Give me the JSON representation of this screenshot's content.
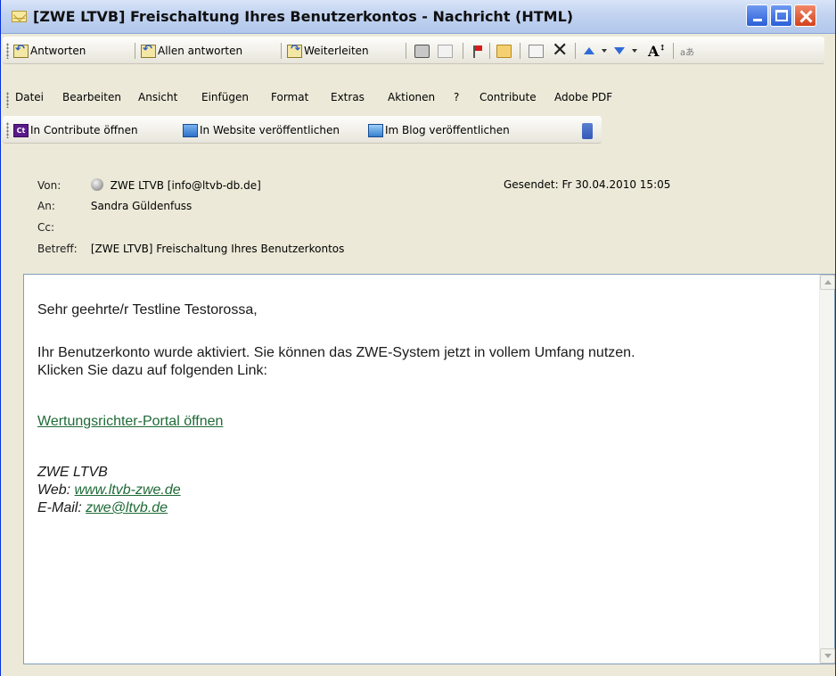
{
  "window": {
    "title": "[ZWE LTVB] Freischaltung Ihres Benutzerkontos - Nachricht (HTML)",
    "accent_color": "#0831D9",
    "close_color": "#D4411C"
  },
  "toolbar": {
    "reply_label": "Antworten",
    "reply_all_label": "Allen antworten",
    "forward_label": "Weiterleiten",
    "icons": [
      "print-icon",
      "copy-icon",
      "flag-icon",
      "folder-icon",
      "move-icon",
      "delete-icon",
      "previous-icon",
      "next-icon",
      "font-size-icon",
      "translate-icon"
    ]
  },
  "menu": {
    "items": [
      "Datei",
      "Bearbeiten",
      "Ansicht",
      "Einfügen",
      "Format",
      "Extras",
      "Aktionen",
      "?",
      "Contribute",
      "Adobe PDF"
    ]
  },
  "contribute_toolbar": {
    "open_label": "In Contribute öffnen",
    "publish_web_label": "In Website veröffentlichen",
    "publish_blog_label": "Im Blog veröffentlichen"
  },
  "header": {
    "from_label": "Von:",
    "from_value": "ZWE LTVB [info@ltvb-db.de]",
    "to_label": "An:",
    "to_value": "Sandra Güldenfuss",
    "cc_label": "Cc:",
    "cc_value": "",
    "subject_label": "Betreff:",
    "subject_value": "[ZWE LTVB] Freischaltung Ihres Benutzerkontos",
    "sent_label": "Gesendet:",
    "sent_value": "Fr 30.04.2010 15:05"
  },
  "message": {
    "greeting": "Sehr geehrte/r Testline Testorossa,",
    "line1": "Ihr Benutzerkonto wurde aktiviert. Sie können das ZWE-System jetzt in vollem Umfang nutzen.",
    "line2": "Klicken Sie dazu auf folgenden Link:",
    "portal_link": "Wertungsrichter-Portal öffnen",
    "sig_name": "ZWE LTVB",
    "sig_web_label": "Web: ",
    "sig_web_link": "www.ltvb-zwe.de",
    "sig_mail_label": "E-Mail: ",
    "sig_mail_link": "zwe@ltvb.de",
    "link_color": "#1E6A36"
  }
}
